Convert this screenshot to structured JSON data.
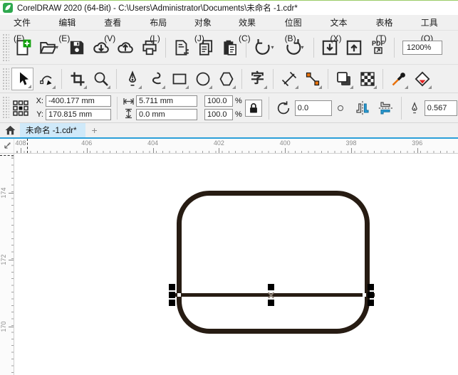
{
  "title_bar": {
    "app_title": "CorelDRAW 2020 (64-Bit) - C:\\Users\\Administrator\\Documents\\未命名 -1.cdr*"
  },
  "menu_bar": {
    "items": [
      "文件(F)",
      "编辑(E)",
      "查看(V)",
      "布局(L)",
      "对象(J)",
      "效果(C)",
      "位图(B)",
      "文本(X)",
      "表格(T)",
      "工具(O)"
    ]
  },
  "standard_toolbar": {
    "zoom_level": "1200%",
    "pdf_label": "PDF",
    "icons": [
      "new-document",
      "open",
      "save",
      "cloud-download",
      "cloud-upload",
      "print",
      "print-merge",
      "copy",
      "paste",
      "undo",
      "redo",
      "import",
      "export",
      "publish-pdf",
      "zoom-level-combo"
    ]
  },
  "toolbox": {
    "active_tool": "pick",
    "text_tool_glyph": "字",
    "tools": [
      "pick",
      "shape",
      "crop",
      "zoom",
      "pen",
      "freehand",
      "rectangle",
      "ellipse",
      "polygon",
      "text",
      "dimension",
      "connector",
      "drop-shadow",
      "transparency",
      "color-eyedropper",
      "smart-fill"
    ]
  },
  "property_bar": {
    "x_label": "X:",
    "x_value": "-400.177 mm",
    "y_label": "Y:",
    "y_value": "170.815 mm",
    "width_value": "5.711 mm",
    "height_value": "0.0 mm",
    "scale_x_value": "100.0",
    "scale_y_value": "100.0",
    "percent_sign": "%",
    "rotation_value": "0.0",
    "outline_width_value": "0.567"
  },
  "document_tabs": {
    "active_tab": "未命名 -1.cdr*",
    "new_tab_label": "+"
  },
  "rulers": {
    "horizontal_labels": [
      "408",
      "406",
      "404",
      "402",
      "400",
      "398",
      "396"
    ],
    "vertical_labels": [
      "174",
      "172",
      "170"
    ]
  },
  "colors": {
    "accent_blue": "#2b9fd9",
    "tab_active_bg": "#cfe9f9",
    "shape_outline": "#271c13",
    "selection_handle": "#000000",
    "new_badge_green": "#13a10e",
    "logo_green": "#2ea84e",
    "tool_orange": "#e8720c",
    "fill_red": "#e11f1f"
  }
}
